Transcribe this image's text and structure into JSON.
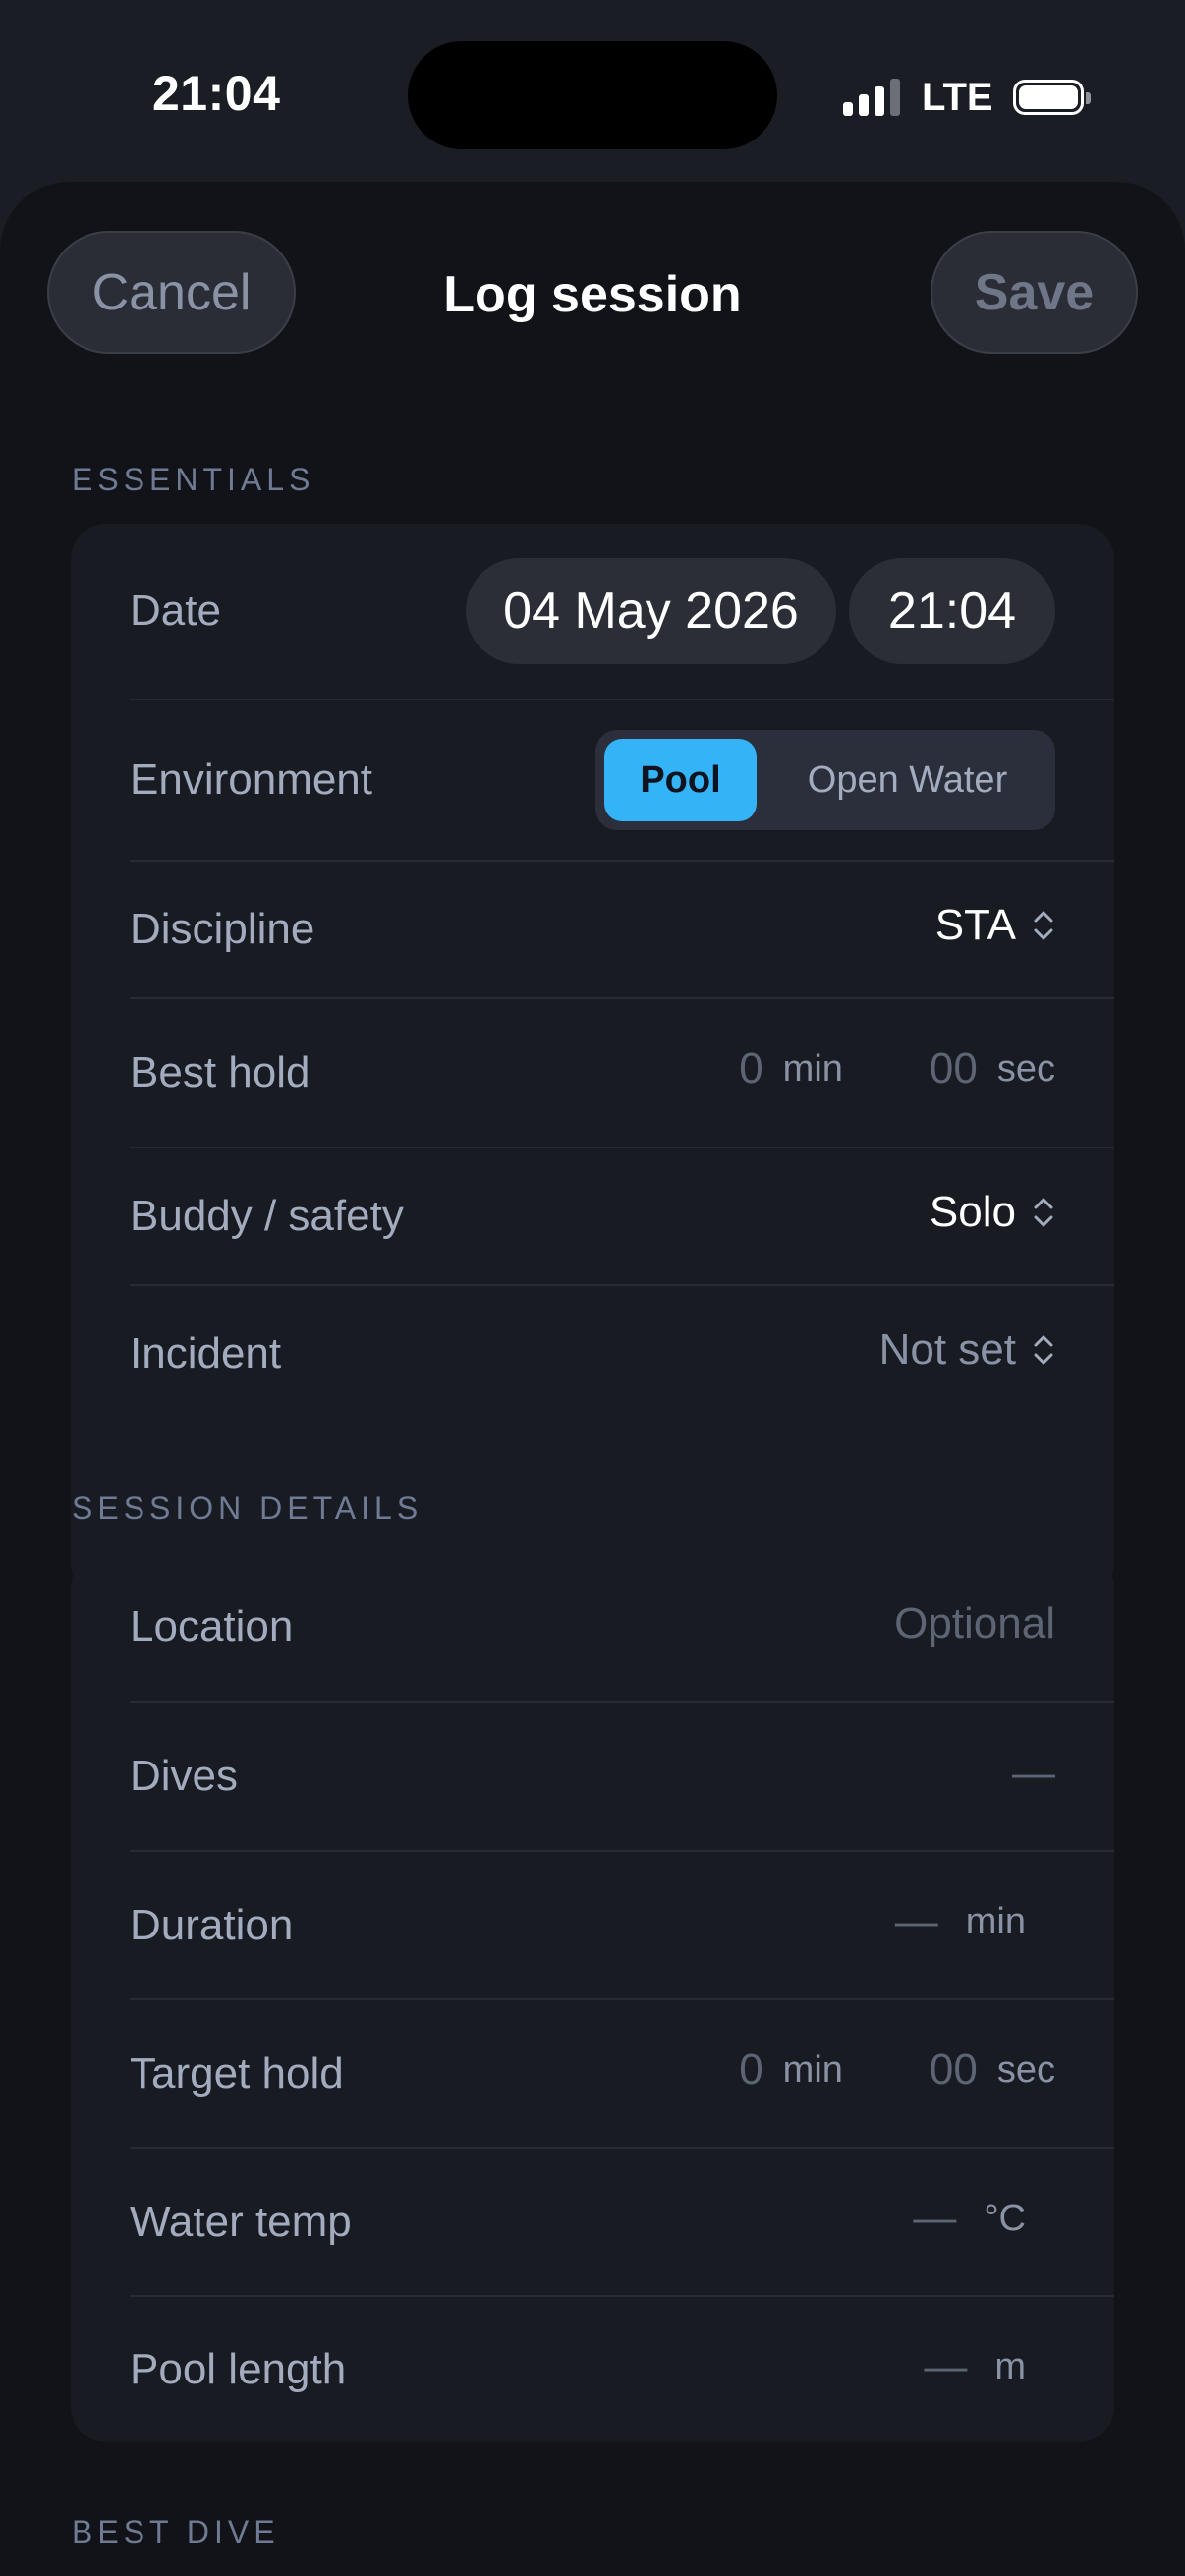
{
  "status": {
    "time": "21:04",
    "network": "LTE"
  },
  "header": {
    "cancel": "Cancel",
    "title": "Log session",
    "save": "Save"
  },
  "essentials": {
    "label": "ESSENTIALS",
    "date": {
      "label": "Date",
      "day": "04 May 2026",
      "time": "21:04"
    },
    "environment": {
      "label": "Environment",
      "options": [
        "Pool",
        "Open Water"
      ],
      "selected": "Pool"
    },
    "discipline": {
      "label": "Discipline",
      "value": "STA"
    },
    "best_hold": {
      "label": "Best hold",
      "min": "0",
      "min_unit": "min",
      "sec": "00",
      "sec_unit": "sec"
    },
    "buddy": {
      "label": "Buddy / safety",
      "value": "Solo"
    },
    "incident": {
      "label": "Incident",
      "value": "Not set"
    }
  },
  "details": {
    "label": "SESSION DETAILS",
    "location": {
      "label": "Location",
      "placeholder": "Optional"
    },
    "dives": {
      "label": "Dives",
      "value": "—"
    },
    "duration": {
      "label": "Duration",
      "value": "—",
      "unit": "min"
    },
    "target_hold": {
      "label": "Target hold",
      "min": "0",
      "min_unit": "min",
      "sec": "00",
      "sec_unit": "sec"
    },
    "water_temp": {
      "label": "Water temp",
      "value": "—",
      "unit": "°C"
    },
    "pool_length": {
      "label": "Pool length",
      "value": "—",
      "unit": "m"
    }
  },
  "best_dive": {
    "label": "BEST DIVE"
  },
  "colors": {
    "accent": "#34b4f6",
    "background": "#111318",
    "card": "#181b22"
  }
}
